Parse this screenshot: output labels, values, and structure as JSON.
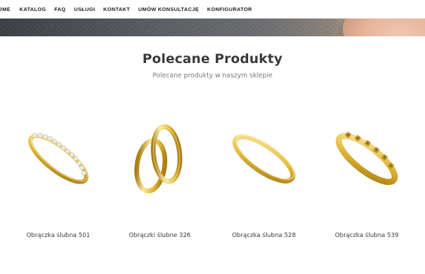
{
  "nav": {
    "items": [
      {
        "label": "OME"
      },
      {
        "label": "KATALOG"
      },
      {
        "label": "FAQ"
      },
      {
        "label": "USŁUGI"
      },
      {
        "label": "KONTAKT"
      },
      {
        "label": "UMÓW KONSULTACJĘ"
      },
      {
        "label": "KONFIGURATOR"
      }
    ]
  },
  "featured": {
    "title": "Polecane Produkty",
    "subtitle": "Polecane produkty w naszym sklepie"
  },
  "products": [
    {
      "name": "Obrączka ślubna 501",
      "image": "diamond-eternity-ring"
    },
    {
      "name": "Obrączki ślubne 326",
      "image": "pair-of-gold-rings"
    },
    {
      "name": "Obrączka ślubna 528",
      "image": "plain-gold-band"
    },
    {
      "name": "Obrączka ślubna 539",
      "image": "gold-ring-with-stones"
    }
  ],
  "colors": {
    "gold_light": "#fbe7a0",
    "gold_mid": "#e2b838",
    "gold_dark": "#a97d14",
    "diamond": "#ecebe6"
  }
}
